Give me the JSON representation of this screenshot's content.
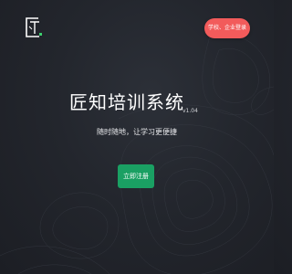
{
  "header": {
    "logo_icon": "jiangzhi-logo-icon",
    "login_label": "学校、企业登录"
  },
  "hero": {
    "title": "匠知培训系统",
    "version": "v1.04",
    "subtitle": "随时随地，让学习更便捷",
    "register_label": "立即注册"
  },
  "colors": {
    "background": "#23262d",
    "login_button": "#f25b5b",
    "register_button": "#1aa063",
    "logo_accent": "#3ccf6e"
  }
}
